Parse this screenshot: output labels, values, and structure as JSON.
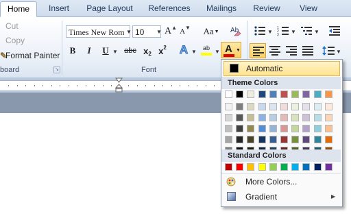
{
  "tabs": [
    "Home",
    "Insert",
    "Page Layout",
    "References",
    "Mailings",
    "Review",
    "View"
  ],
  "clipboard": {
    "cut_label": "Cut",
    "copy_label": "Copy",
    "format_painter_label": "Format Painter",
    "group_label": "board"
  },
  "font": {
    "font_name": "Times New Rom",
    "font_size": "10",
    "group_label": "Font",
    "grow_glyph": "A",
    "shrink_glyph": "A",
    "change_case_glyph": "Aa",
    "bold_glyph": "B",
    "italic_glyph": "I",
    "underline_glyph": "U",
    "strike_glyph": "abc",
    "subscript_glyph": "x",
    "subscript_sub": "2",
    "superscript_glyph": "x",
    "superscript_sup": "2",
    "effects_glyph": "A",
    "highlight_glyph": "ab",
    "font_color_glyph": "A"
  },
  "font_color_menu": {
    "automatic_label": "Automatic",
    "theme_colors_label": "Theme Colors",
    "standard_colors_label": "Standard Colors",
    "more_colors_label": "More Colors...",
    "gradient_label": "Gradient",
    "theme_top": [
      "#ffffff",
      "#000000",
      "#eeece1",
      "#1f497d",
      "#4f81bd",
      "#c0504d",
      "#9bbb59",
      "#8064a2",
      "#4bacc6",
      "#f79646"
    ],
    "theme_shades": [
      [
        "#f2f2f2",
        "#7f7f7f",
        "#ddd9c3",
        "#c6d9f0",
        "#dbe5f1",
        "#f2dcdb",
        "#ebf1dd",
        "#e5e0ec",
        "#dbeef3",
        "#fdeada"
      ],
      [
        "#d8d8d8",
        "#595959",
        "#c4bd97",
        "#8db3e2",
        "#b8cce4",
        "#e5b9b7",
        "#d7e3bc",
        "#ccc1d9",
        "#b7dde8",
        "#fbd5b5"
      ],
      [
        "#bfbfbf",
        "#3f3f3f",
        "#938953",
        "#548dd4",
        "#95b3d7",
        "#d99694",
        "#c3d69b",
        "#b2a2c7",
        "#92cddc",
        "#fac08f"
      ],
      [
        "#a5a5a5",
        "#262626",
        "#494429",
        "#17365d",
        "#366092",
        "#953734",
        "#76923c",
        "#5f497a",
        "#31859b",
        "#e36c09"
      ],
      [
        "#7f7f7f",
        "#0c0c0c",
        "#1d1b10",
        "#0f243e",
        "#244061",
        "#632423",
        "#4f6128",
        "#3f3151",
        "#205867",
        "#974806"
      ]
    ],
    "standard": [
      "#c00000",
      "#ff0000",
      "#ffc000",
      "#ffff00",
      "#92d050",
      "#00b050",
      "#00b0f0",
      "#0070c0",
      "#002060",
      "#7030a0"
    ]
  }
}
